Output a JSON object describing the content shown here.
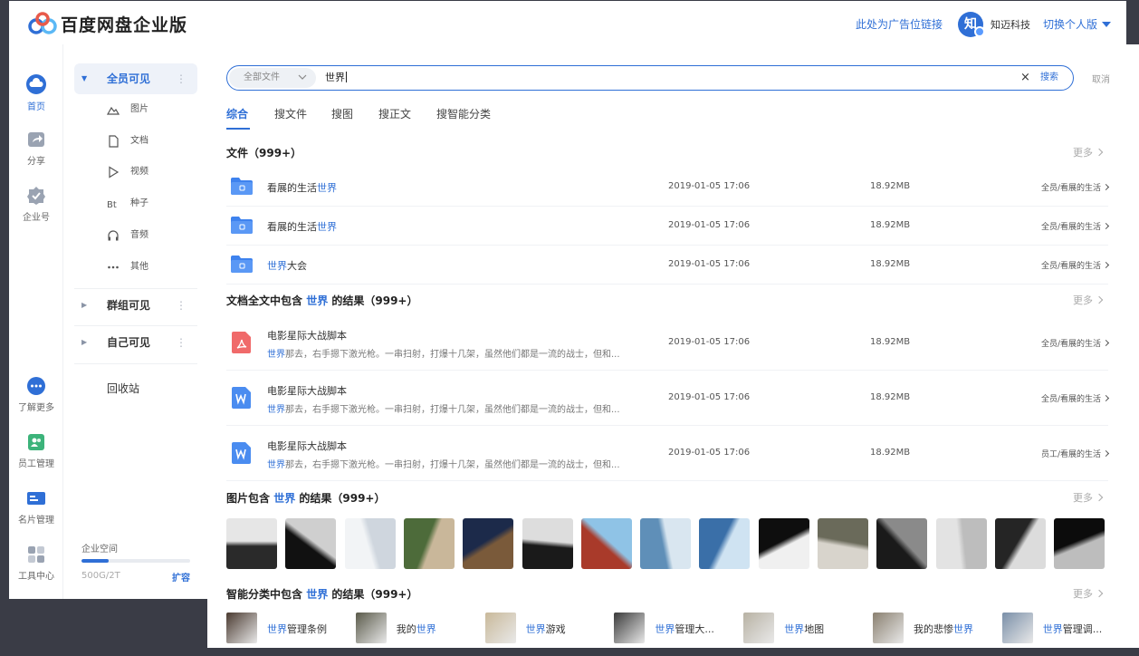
{
  "header": {
    "brand": "百度网盘企业版",
    "ad_link": "此处为广告位链接",
    "avatar_char": "知",
    "org_name": "知迈科技",
    "switch_label": "切换个人版"
  },
  "rail": {
    "items": [
      {
        "label": "首页",
        "icon": "cloud-icon"
      },
      {
        "label": "分享",
        "icon": "share-icon"
      },
      {
        "label": "企业号",
        "icon": "badge-icon"
      },
      {
        "label": "了解更多",
        "icon": "more-circle-icon"
      },
      {
        "label": "员工管理",
        "icon": "staff-icon"
      },
      {
        "label": "名片管理",
        "icon": "card-icon"
      },
      {
        "label": "工具中心",
        "icon": "tools-icon"
      }
    ]
  },
  "side": {
    "groups": [
      {
        "label": "全员可见"
      },
      {
        "label": "群组可见"
      },
      {
        "label": "自己可见"
      }
    ],
    "sub_items": [
      {
        "label": "图片",
        "icon": "image-icon"
      },
      {
        "label": "文档",
        "icon": "doc-icon"
      },
      {
        "label": "视频",
        "icon": "video-icon"
      },
      {
        "label": "种子",
        "icon": "bt-icon"
      },
      {
        "label": "音频",
        "icon": "audio-icon"
      },
      {
        "label": "其他",
        "icon": "other-icon"
      }
    ],
    "recycle": "回收站",
    "storage_label": "企业空间",
    "storage_text": "500G/2T",
    "storage_used_fraction": 0.25,
    "expand": "扩容"
  },
  "search": {
    "scope": "全部文件",
    "query": "世界",
    "clear": "×",
    "button": "搜索",
    "cancel": "取消"
  },
  "tabs": [
    "综合",
    "搜文件",
    "搜图",
    "搜正文",
    "搜智能分类"
  ],
  "sections": {
    "files": {
      "title": "文件（999+）",
      "more": "更多"
    },
    "docs": {
      "title_pre": "文档全文中包含 ",
      "title_kw": "世界",
      "title_post": " 的结果（999+）",
      "more": "更多"
    },
    "images": {
      "title_pre": "图片包含 ",
      "title_kw": "世界",
      "title_post": " 的结果（999+）",
      "more": "更多"
    },
    "cats": {
      "title_pre": "智能分类中包含 ",
      "title_kw": "世界",
      "title_post": " 的结果（999+）",
      "more": "更多"
    }
  },
  "files": [
    {
      "pre": "看展的生活",
      "kw": "世界",
      "post": "",
      "date": "2019-01-05 17:06",
      "size": "18.92MB",
      "path": "全员/看展的生活"
    },
    {
      "pre": "看展的生活",
      "kw": "世界",
      "post": "",
      "date": "2019-01-05 17:06",
      "size": "18.92MB",
      "path": "全员/看展的生活"
    },
    {
      "pre": "",
      "kw": "世界",
      "post": "大会",
      "date": "2019-01-05 17:06",
      "size": "18.92MB",
      "path": "全员/看展的生活"
    }
  ],
  "docs": [
    {
      "type": "pdf",
      "name": "电影星际大战脚本",
      "snip_kw": "世界",
      "snip": "那去，右手摁下激光枪。一串扫射，打爆十几架，虽然他们都是一流的战士，但和...",
      "date": "2019-01-05 17:06",
      "size": "18.92MB",
      "path": "全员/看展的生活"
    },
    {
      "type": "word",
      "name": "电影星际大战脚本",
      "snip_kw": "世界",
      "snip": "那去，右手摁下激光枪。一串扫射，打爆十几架，虽然他们都是一流的战士，但和...",
      "date": "2019-01-05 17:06",
      "size": "18.92MB",
      "path": "全员/看展的生活"
    },
    {
      "type": "word",
      "name": "电影星际大战脚本",
      "snip_kw": "世界",
      "snip": "那去，右手摁下激光枪。一串扫射，打爆十几架，虽然他们都是一流的战士，但和...",
      "date": "2019-01-05 17:06",
      "size": "18.92MB",
      "path": "员工/看展的生活"
    }
  ],
  "thumb_colors": [
    [
      "#2a2a2a",
      "#e6e6e6"
    ],
    [
      "#111111",
      "#cfcfcf"
    ],
    [
      "#f2f4f6",
      "#cfd6de"
    ],
    [
      "#4d6b3a",
      "#c9b79a"
    ],
    [
      "#1c2a4a",
      "#7a5a3a"
    ],
    [
      "#1a1a1a",
      "#dddddd"
    ],
    [
      "#a93a2a",
      "#8fc3e6"
    ],
    [
      "#5f8fb8",
      "#d9e6f0"
    ],
    [
      "#3a6fa8",
      "#cfe3f2"
    ],
    [
      "#0e0e0e",
      "#f0f0f0"
    ],
    [
      "#d8d4cc",
      "#6a6a5a"
    ],
    [
      "#1a1a1a",
      "#8a8a8a"
    ],
    [
      "#e3e3e3",
      "#bdbdbd"
    ],
    [
      "#252525",
      "#dcdcdc"
    ],
    [
      "#0c0c0c",
      "#bdbdbd"
    ]
  ],
  "cats": [
    {
      "pre": "",
      "kw": "世界",
      "post": "管理条例",
      "color": "#4a3a30"
    },
    {
      "pre": "我的",
      "kw": "世界",
      "post": "",
      "color": "#5a5a4a"
    },
    {
      "pre": "",
      "kw": "世界",
      "post": "游戏",
      "color": "#c9b99a"
    },
    {
      "pre": "",
      "kw": "世界",
      "post": "管理大...",
      "color": "#3a3a3a"
    },
    {
      "pre": "",
      "kw": "世界",
      "post": "地图",
      "color": "#b8b2a4"
    },
    {
      "pre": "我的悲惨",
      "kw": "世界",
      "post": "",
      "color": "#8a8070"
    },
    {
      "pre": "",
      "kw": "世界",
      "post": "管理调...",
      "color": "#7a8fa8"
    }
  ],
  "colors": {
    "accent": "#2f6fd6",
    "folder": "#3e82ee",
    "pdf": "#f06a6a",
    "word": "#4a8cf0"
  }
}
